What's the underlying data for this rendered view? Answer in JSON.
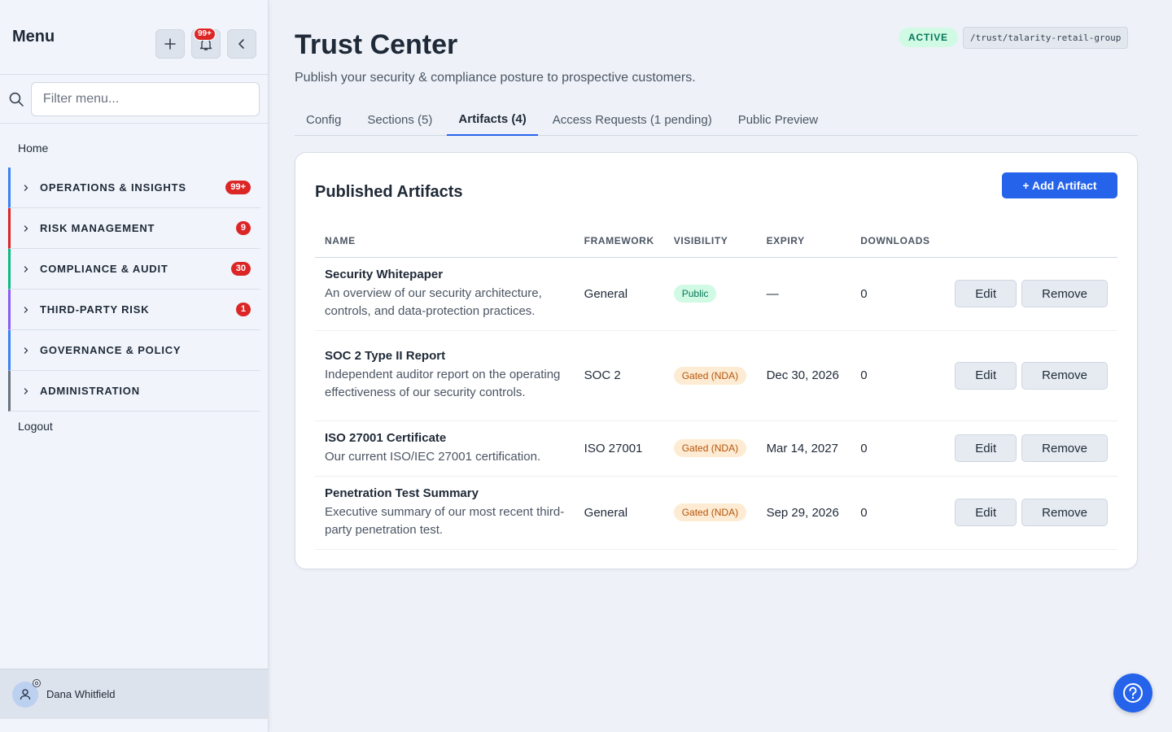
{
  "sidebar": {
    "title": "Menu",
    "notification_badge": "99+",
    "filter_placeholder": "Filter menu...",
    "home_label": "Home",
    "groups": [
      {
        "label": "OPERATIONS & INSIGHTS",
        "count": "99+",
        "color": "#3b82f6"
      },
      {
        "label": "RISK MANAGEMENT",
        "count": "9",
        "color": "#dc2626"
      },
      {
        "label": "COMPLIANCE & AUDIT",
        "count": "30",
        "color": "#10b981"
      },
      {
        "label": "THIRD-PARTY RISK",
        "count": "1",
        "color": "#8b5cf6"
      },
      {
        "label": "GOVERNANCE & POLICY",
        "count": "",
        "color": "#3b82f6"
      },
      {
        "label": "ADMINISTRATION",
        "count": "",
        "color": "#6b7280"
      }
    ],
    "logout_label": "Logout",
    "user_name": "Dana Whitfield"
  },
  "page": {
    "title": "Trust Center",
    "subtitle": "Publish your security & compliance posture to prospective customers.",
    "status": "ACTIVE",
    "path": "/trust/talarity-retail-group"
  },
  "tabs": [
    {
      "label": "Config",
      "active": false
    },
    {
      "label": "Sections (5)",
      "active": false
    },
    {
      "label": "Artifacts (4)",
      "active": true
    },
    {
      "label": "Access Requests (1 pending)",
      "active": false
    },
    {
      "label": "Public Preview",
      "active": false
    }
  ],
  "card": {
    "title": "Published Artifacts",
    "add_label": "+ Add Artifact",
    "columns": [
      "NAME",
      "FRAMEWORK",
      "VISIBILITY",
      "EXPIRY",
      "DOWNLOADS"
    ],
    "edit_label": "Edit",
    "remove_label": "Remove",
    "rows": [
      {
        "name": "Security Whitepaper",
        "desc": "An overview of our security architecture, controls, and data-protection practices.",
        "framework": "General",
        "visibility": "Public",
        "vis_type": "public",
        "expiry": "—",
        "downloads": "0"
      },
      {
        "name": "SOC 2 Type II Report",
        "desc": "Independent auditor report on the operating effectiveness of our security controls.",
        "framework": "SOC 2",
        "visibility": "Gated (NDA)",
        "vis_type": "gated",
        "expiry": "Dec 30, 2026",
        "downloads": "0"
      },
      {
        "name": "ISO 27001 Certificate",
        "desc": "Our current ISO/IEC 27001 certification.",
        "framework": "ISO 27001",
        "visibility": "Gated (NDA)",
        "vis_type": "gated",
        "expiry": "Mar 14, 2027",
        "downloads": "0"
      },
      {
        "name": "Penetration Test Summary",
        "desc": "Executive summary of our most recent third-party penetration test.",
        "framework": "General",
        "visibility": "Gated (NDA)",
        "vis_type": "gated",
        "expiry": "Sep 29, 2026",
        "downloads": "0"
      }
    ]
  },
  "colors": {
    "accent": "#2563eb",
    "badge": "#dc2626",
    "public": "#047857",
    "gated": "#b45309"
  }
}
